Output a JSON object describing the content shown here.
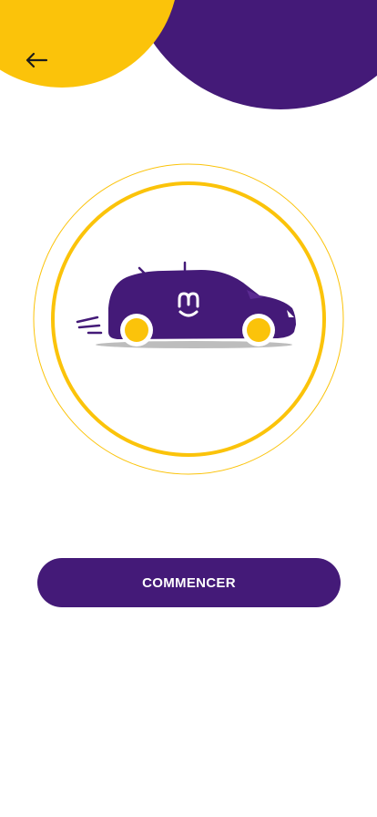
{
  "colors": {
    "brand_purple": "#441a78",
    "brand_yellow": "#fbc30a",
    "background": "#ffffff"
  },
  "header": {
    "back_icon": "arrow-left-icon"
  },
  "illustration": {
    "subject": "car-icon",
    "logo_icon": "brand-m-logo-icon"
  },
  "cta": {
    "label": "COMMENCER"
  }
}
